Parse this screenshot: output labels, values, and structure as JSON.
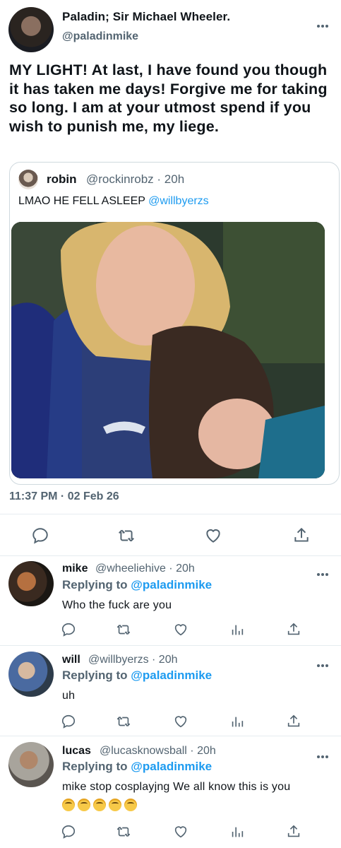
{
  "main_tweet": {
    "display_name": "Paladin; Sir Michael Wheeler.",
    "handle": "@paladinmike",
    "text": "MY LIGHT! At last, I have found you though it has taken me days! Forgive me for taking so long. I am at your utmost spend if you wish to punish me, my liege.",
    "timestamp": "11:37 PM · 02 Feb 26",
    "more_icon": "more-horizontal-icon"
  },
  "quoted_tweet": {
    "display_name": "robin",
    "handle_time": "@rockinrobz · 20h",
    "text": "LMAO HE FELL ASLEEP ",
    "mention": "@willbyerzs"
  },
  "actions": {
    "icons": [
      "reply-icon",
      "retweet-icon",
      "like-icon",
      "share-icon"
    ]
  },
  "replies": [
    {
      "display_name": "mike",
      "handle_time": "@wheeliehive · 20h",
      "replying_label": "Replying to ",
      "replying_to": "@paladinmike",
      "text": "Who the fuck are you"
    },
    {
      "display_name": "will",
      "handle_time": "@willbyerzs · 20h",
      "replying_label": "Replying to ",
      "replying_to": "@paladinmike",
      "text": "uh"
    },
    {
      "display_name": "lucas",
      "handle_time": "@lucasknowsball · 20h",
      "replying_label": "Replying to ",
      "replying_to": "@paladinmike",
      "text": "mike stop cosplayjng We all know this is you",
      "emoji": [
        "loudly-crying-face",
        "loudly-crying-face",
        "loudly-crying-face",
        "loudly-crying-face",
        "loudly-crying-face"
      ]
    }
  ],
  "colors": {
    "link": "#1d9bf0",
    "secondary_text": "#536471",
    "divider": "#e6ecf0",
    "primary_text": "#0f1419"
  }
}
